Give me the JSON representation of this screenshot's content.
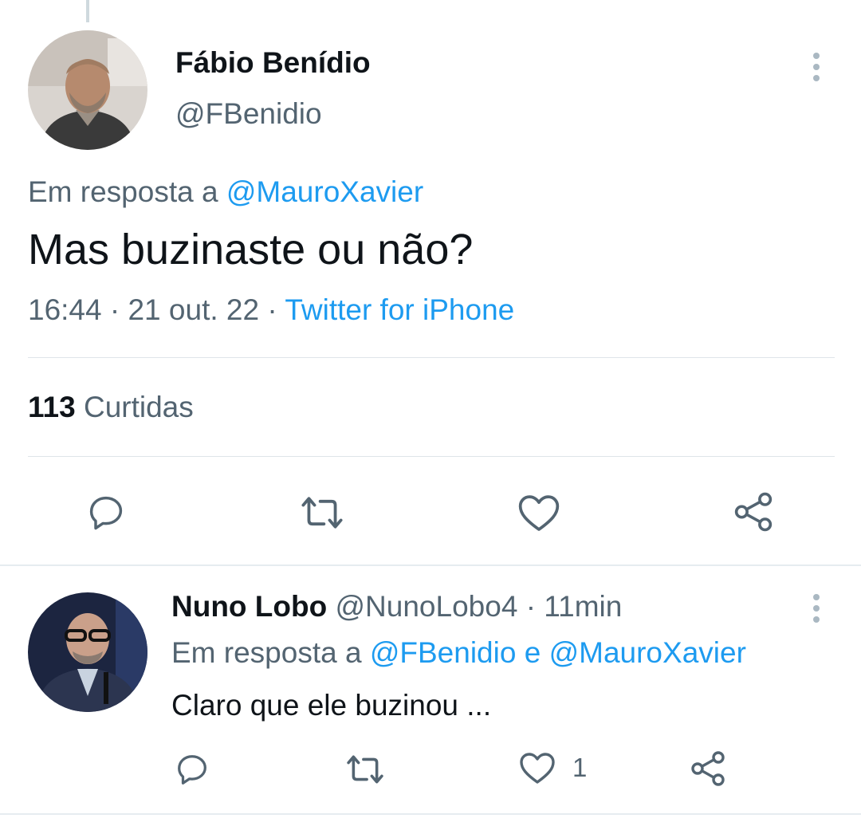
{
  "main_tweet": {
    "author_name": "Fábio Benídio",
    "author_handle": "@FBenidio",
    "reply_prefix": "Em resposta a",
    "reply_mention": "@MauroXavier",
    "text": "Mas buzinaste ou não?",
    "time": "16:44",
    "date": "21 out. 22",
    "separator": "·",
    "source": "Twitter for iPhone",
    "likes_count": "113",
    "likes_label": "Curtidas",
    "actions": [
      "reply-icon",
      "retweet-icon",
      "like-icon",
      "share-icon"
    ]
  },
  "reply_tweet": {
    "author_name": "Nuno Lobo",
    "author_handle": "@NunoLobo4",
    "separator": "·",
    "time_ago": "11min",
    "reply_prefix": "Em resposta a",
    "reply_mention_1": "@FBenidio",
    "reply_conjunction": "e",
    "reply_mention_2": "@MauroXavier",
    "text": "Claro que ele buzinou ...",
    "like_count": "1",
    "actions": [
      "reply-icon",
      "retweet-icon",
      "like-icon",
      "share-icon"
    ]
  },
  "colors": {
    "link": "#1d9bf0",
    "secondary_text": "#536471",
    "primary_text": "#0f1419",
    "icon": "#536471"
  }
}
